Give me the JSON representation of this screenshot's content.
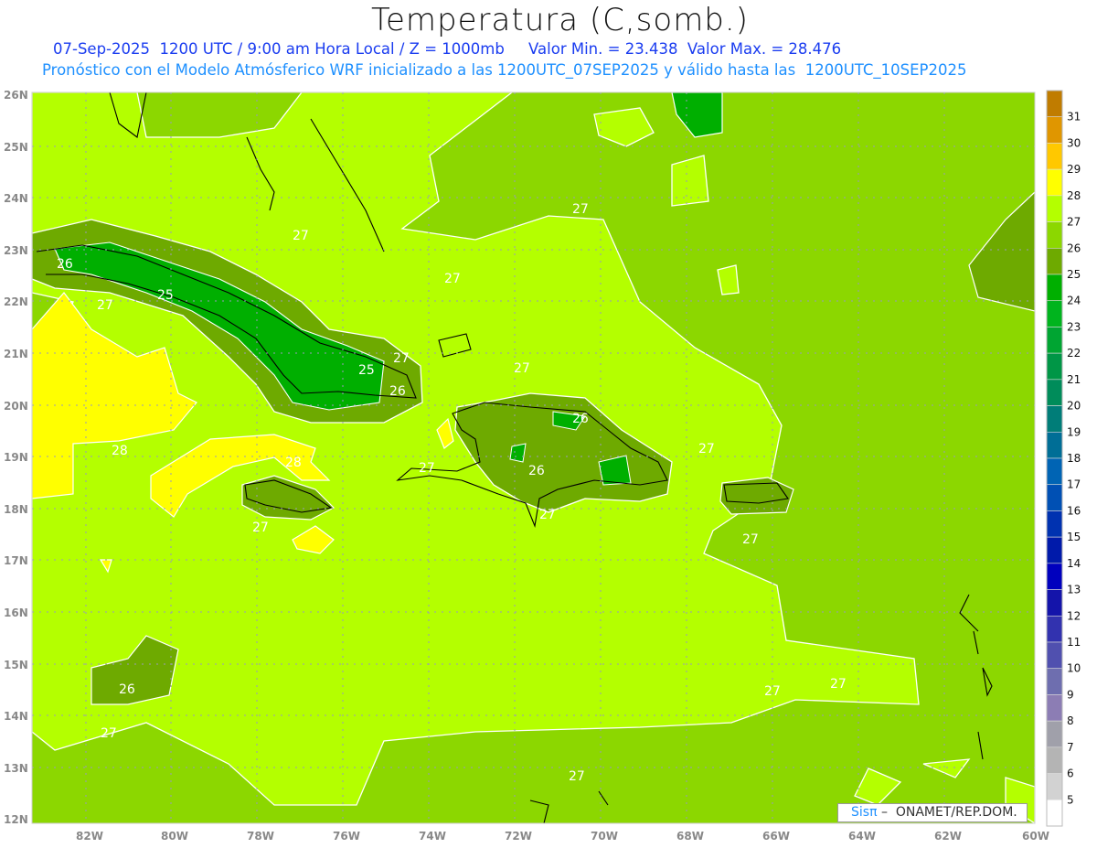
{
  "header": {
    "title": "Temperatura (C,somb.)",
    "line1": "07-Sep-2025  1200 UTC / 9:00 am Hora Local / Z = 1000mb     Valor Min. = 23.438  Valor Max. = 28.476",
    "line2": "Pronóstico con el Modelo Atmósferico WRF inicializado a las 1200UTC_07SEP2025 y válido hasta las  1200UTC_10SEP2025"
  },
  "axes": {
    "lon_labels": [
      "82W",
      "80W",
      "78W",
      "76W",
      "74W",
      "72W",
      "70W",
      "68W",
      "66W",
      "64W",
      "62W",
      "60W"
    ],
    "lat_labels": [
      "26N",
      "25N",
      "24N",
      "23N",
      "22N",
      "21N",
      "20N",
      "19N",
      "18N",
      "17N",
      "16N",
      "15N",
      "14N",
      "13N",
      "12N"
    ]
  },
  "colorbar": {
    "labels": [
      "31",
      "30",
      "29",
      "28",
      "27",
      "26",
      "25",
      "24",
      "23",
      "22",
      "21",
      "20",
      "19",
      "18",
      "17",
      "16",
      "15",
      "14",
      "13",
      "12",
      "11",
      "10",
      "9",
      "8",
      "7",
      "6",
      "5"
    ],
    "colors": [
      "#c07c00",
      "#e09600",
      "#ffc800",
      "#ffff00",
      "#b4ff00",
      "#8cd700",
      "#6eaa00",
      "#00af00",
      "#00b41e",
      "#00a532",
      "#009646",
      "#008c5a",
      "#007d78",
      "#006e96",
      "#0064b4",
      "#0050b4",
      "#0032b0",
      "#001aaa",
      "#0000be",
      "#1414aa",
      "#3232af",
      "#5050af",
      "#6e6eaf",
      "#8c7db4",
      "#a0a0aa",
      "#b4b4b4",
      "#d2d2d2",
      "#ffffff"
    ]
  },
  "contour_labels": [
    {
      "text": "27"
    },
    {
      "text": "27"
    },
    {
      "text": "26"
    },
    {
      "text": "27"
    },
    {
      "text": "25"
    },
    {
      "text": "27"
    },
    {
      "text": "25"
    },
    {
      "text": "26"
    },
    {
      "text": "27"
    },
    {
      "text": "28"
    },
    {
      "text": "28"
    },
    {
      "text": "27"
    },
    {
      "text": "26"
    },
    {
      "text": "26"
    },
    {
      "text": "27"
    },
    {
      "text": "27"
    },
    {
      "text": "27"
    },
    {
      "text": "27"
    },
    {
      "text": "27"
    },
    {
      "text": "26"
    },
    {
      "text": "27"
    },
    {
      "text": "27"
    },
    {
      "text": "27"
    },
    {
      "text": "27"
    }
  ],
  "credit": {
    "logo": "Sisπ",
    "text": " –  ONAMET/REP.DOM."
  }
}
